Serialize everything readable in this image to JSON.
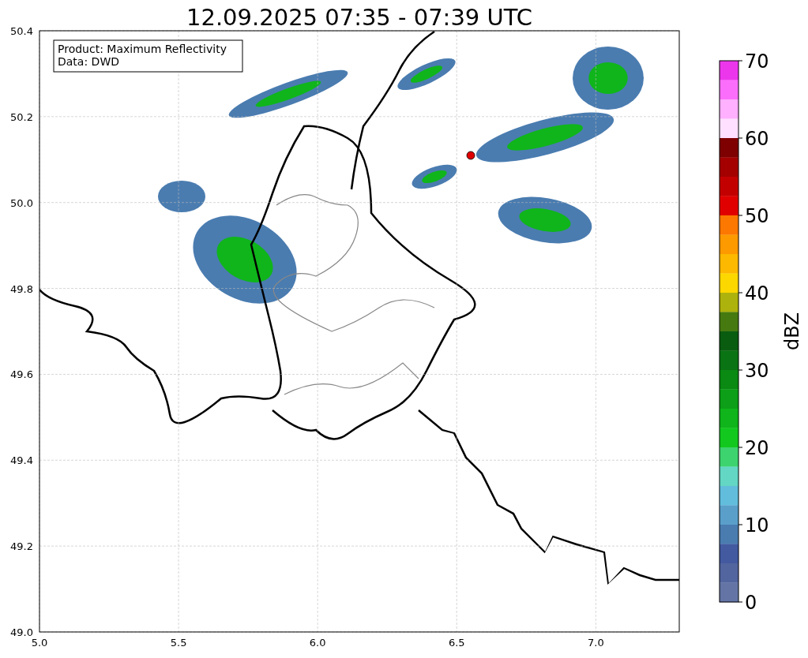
{
  "title": "12.09.2025 07:35 - 07:39 UTC",
  "legend": [
    "Product: Maximum Reflectivity",
    "Data: DWD"
  ],
  "map": {
    "xticks": [
      "5.0",
      "5.5",
      "6.0",
      "6.5",
      "7.0"
    ],
    "yticks": [
      "50.4",
      "50.2",
      "50.0",
      "49.8",
      "49.6",
      "49.4",
      "49.2",
      "49.0"
    ]
  },
  "colorbar": {
    "label": "dBZ",
    "ticks": [
      "70",
      "60",
      "50",
      "40",
      "30",
      "20",
      "10",
      "0"
    ],
    "bands": [
      {
        "color": "#ec36ec"
      },
      {
        "color": "#fb6efb"
      },
      {
        "color": "#ffb0ff"
      },
      {
        "color": "#ffe0ff"
      },
      {
        "color": "#7e0000"
      },
      {
        "color": "#a40000"
      },
      {
        "color": "#c30000"
      },
      {
        "color": "#e10000"
      },
      {
        "color": "#fd7800"
      },
      {
        "color": "#fd9a00"
      },
      {
        "color": "#fdb800"
      },
      {
        "color": "#fdd700"
      },
      {
        "color": "#aeb20c"
      },
      {
        "color": "#467a10"
      },
      {
        "color": "#095c10"
      },
      {
        "color": "#0a7313"
      },
      {
        "color": "#0a8913"
      },
      {
        "color": "#0c9f17"
      },
      {
        "color": "#0fb51a"
      },
      {
        "color": "#12c81e"
      },
      {
        "color": "#3dd36e"
      },
      {
        "color": "#63d6c4"
      },
      {
        "color": "#62bddc"
      },
      {
        "color": "#5a9fca"
      },
      {
        "color": "#4a7cb0"
      },
      {
        "color": "#435aa0"
      },
      {
        "color": "#52659f"
      },
      {
        "color": "#6475a5"
      }
    ]
  }
}
